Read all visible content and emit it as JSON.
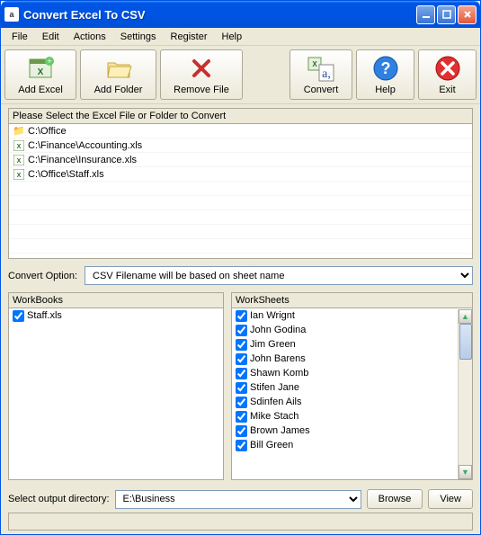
{
  "window": {
    "title": "Convert Excel To CSV"
  },
  "menubar": {
    "items": [
      "File",
      "Edit",
      "Actions",
      "Settings",
      "Register",
      "Help"
    ]
  },
  "toolbar": {
    "add_excel": "Add Excel",
    "add_folder": "Add Folder",
    "remove_file": "Remove File",
    "convert": "Convert",
    "help": "Help",
    "exit": "Exit"
  },
  "file_panel": {
    "header": "Please Select the Excel File or Folder to Convert",
    "rows": [
      {
        "type": "folder",
        "path": "C:\\Office"
      },
      {
        "type": "xls",
        "path": "C:\\Finance\\Accounting.xls"
      },
      {
        "type": "xls",
        "path": "C:\\Finance\\Insurance.xls"
      },
      {
        "type": "xls",
        "path": "C:\\Office\\Staff.xls"
      }
    ]
  },
  "convert_option": {
    "label": "Convert Option:",
    "value": "CSV Filename will be based on sheet name"
  },
  "workbooks": {
    "header": "WorkBooks",
    "items": [
      {
        "checked": true,
        "name": "Staff.xls"
      }
    ]
  },
  "worksheets": {
    "header": "WorkSheets",
    "items": [
      {
        "checked": true,
        "name": "Ian Wrignt"
      },
      {
        "checked": true,
        "name": "John Godina"
      },
      {
        "checked": true,
        "name": "Jim Green"
      },
      {
        "checked": true,
        "name": "John Barens"
      },
      {
        "checked": true,
        "name": "Shawn Komb"
      },
      {
        "checked": true,
        "name": "Stifen Jane"
      },
      {
        "checked": true,
        "name": "Sdinfen Ails"
      },
      {
        "checked": true,
        "name": "Mike Stach"
      },
      {
        "checked": true,
        "name": "Brown James"
      },
      {
        "checked": true,
        "name": "Bill Green"
      }
    ]
  },
  "output": {
    "label": "Select  output directory:",
    "value": "E:\\Business",
    "browse": "Browse",
    "view": "View"
  }
}
